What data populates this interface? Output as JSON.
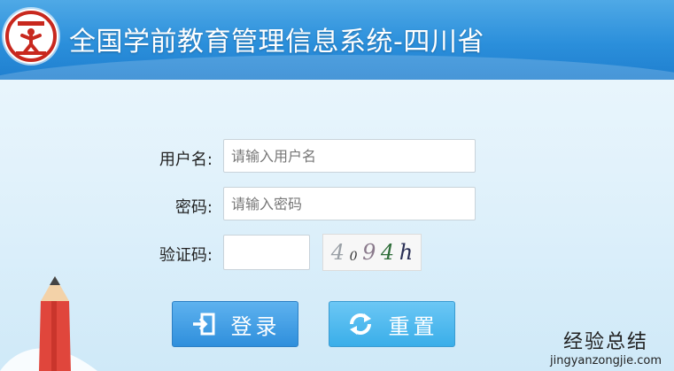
{
  "header": {
    "title": "全国学前教育管理信息系统-四川省"
  },
  "form": {
    "username_label": "用户名:",
    "username_placeholder": "请输入用户名",
    "password_label": "密码:",
    "password_placeholder": "请输入密码",
    "captcha_label": "验证码:",
    "captcha_value": "",
    "captcha_chars": [
      "4",
      "0",
      "9",
      "4",
      "h"
    ]
  },
  "buttons": {
    "login_label": "登录",
    "reset_label": "重置"
  },
  "watermark": {
    "text": "经验总结",
    "url": "jingyanzongjie.com"
  },
  "colors": {
    "header_blue": "#2b8fdb",
    "logo_red": "#c8281e",
    "login_blue": "#2f8fdc",
    "reset_blue": "#3aaee9"
  }
}
